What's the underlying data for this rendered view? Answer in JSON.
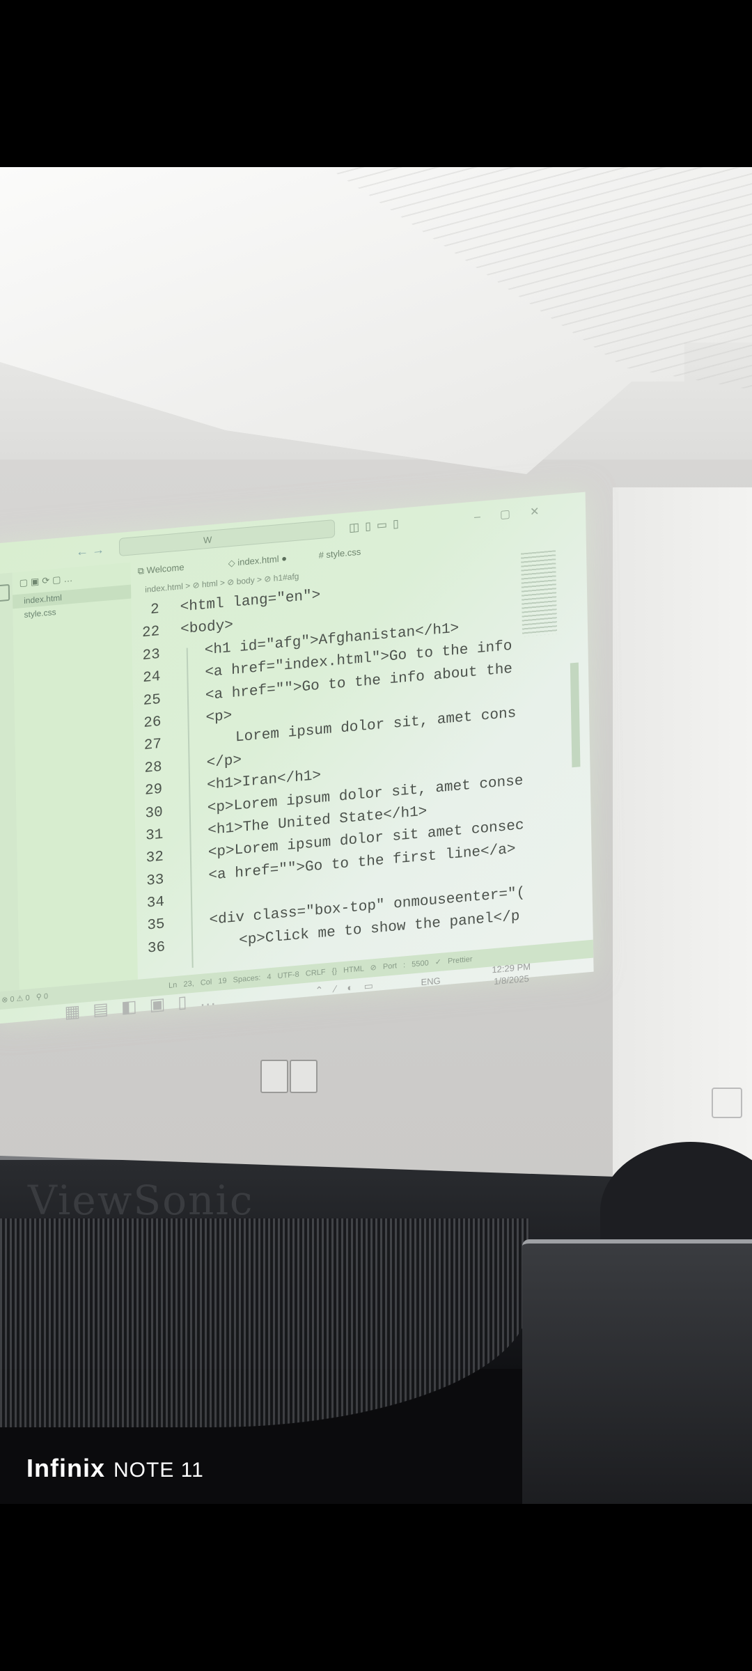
{
  "editor": {
    "search_placeholder": "W",
    "tabs": [
      {
        "label": "Welcome"
      },
      {
        "label": "index.html",
        "modified_marker": "●"
      },
      {
        "label": "style.css"
      }
    ],
    "explorer": {
      "files": [
        "index.html",
        "style.css"
      ]
    },
    "breadcrumb": "index.html > ⊘ html > ⊘ body > ⊘ h1#afg",
    "code_lines": [
      {
        "num": "2",
        "text": "<html lang=\"en\">"
      },
      {
        "num": "22",
        "text": "<body>"
      },
      {
        "num": "23",
        "text": "<h1 id=\"afg\">Afghanistan</h1>"
      },
      {
        "num": "24",
        "text": "<a href=\"index.html\">Go to the info"
      },
      {
        "num": "25",
        "text": "<a href=\"\">Go to the info about the"
      },
      {
        "num": "26",
        "text": "<p>"
      },
      {
        "num": "27",
        "text": "Lorem ipsum dolor sit, amet cons"
      },
      {
        "num": "28",
        "text": "</p>"
      },
      {
        "num": "29",
        "text": "<h1>Iran</h1>"
      },
      {
        "num": "30",
        "text": "<p>Lorem ipsum dolor sit, amet conse"
      },
      {
        "num": "31",
        "text": "<h1>The United State</h1>"
      },
      {
        "num": "32",
        "text": "<p>Lorem ipsum dolor sit amet consec"
      },
      {
        "num": "33",
        "text": "<a href=\"\">Go to the first line</a>"
      },
      {
        "num": "34",
        "text": ""
      },
      {
        "num": "35",
        "text": "<div class=\"box-top\" onmouseenter=\"("
      },
      {
        "num": "36",
        "text": "<p>Click me to show the panel</p"
      }
    ],
    "status": {
      "problems": "⊗ 0 ⚠ 0",
      "ports": "⚲ 0",
      "position": "Ln 23, Col 19",
      "spaces": "Spaces: 4",
      "encoding": "UTF-8",
      "eol": "CRLF",
      "language": "{} HTML",
      "port": "⊘ Port : 5500",
      "formatter": "✓ Prettier"
    }
  },
  "taskbar": {
    "language": "ENG",
    "time": "12:29 PM",
    "date": "1/8/2025"
  },
  "photo_watermark": {
    "brand": "Infinix",
    "model": "NOTE 11"
  },
  "monitor_brand": "ViewSonic",
  "colors": {
    "projection_bg": "#d9eed0",
    "code_text": "#4c524c",
    "black_bar": "#000000"
  }
}
